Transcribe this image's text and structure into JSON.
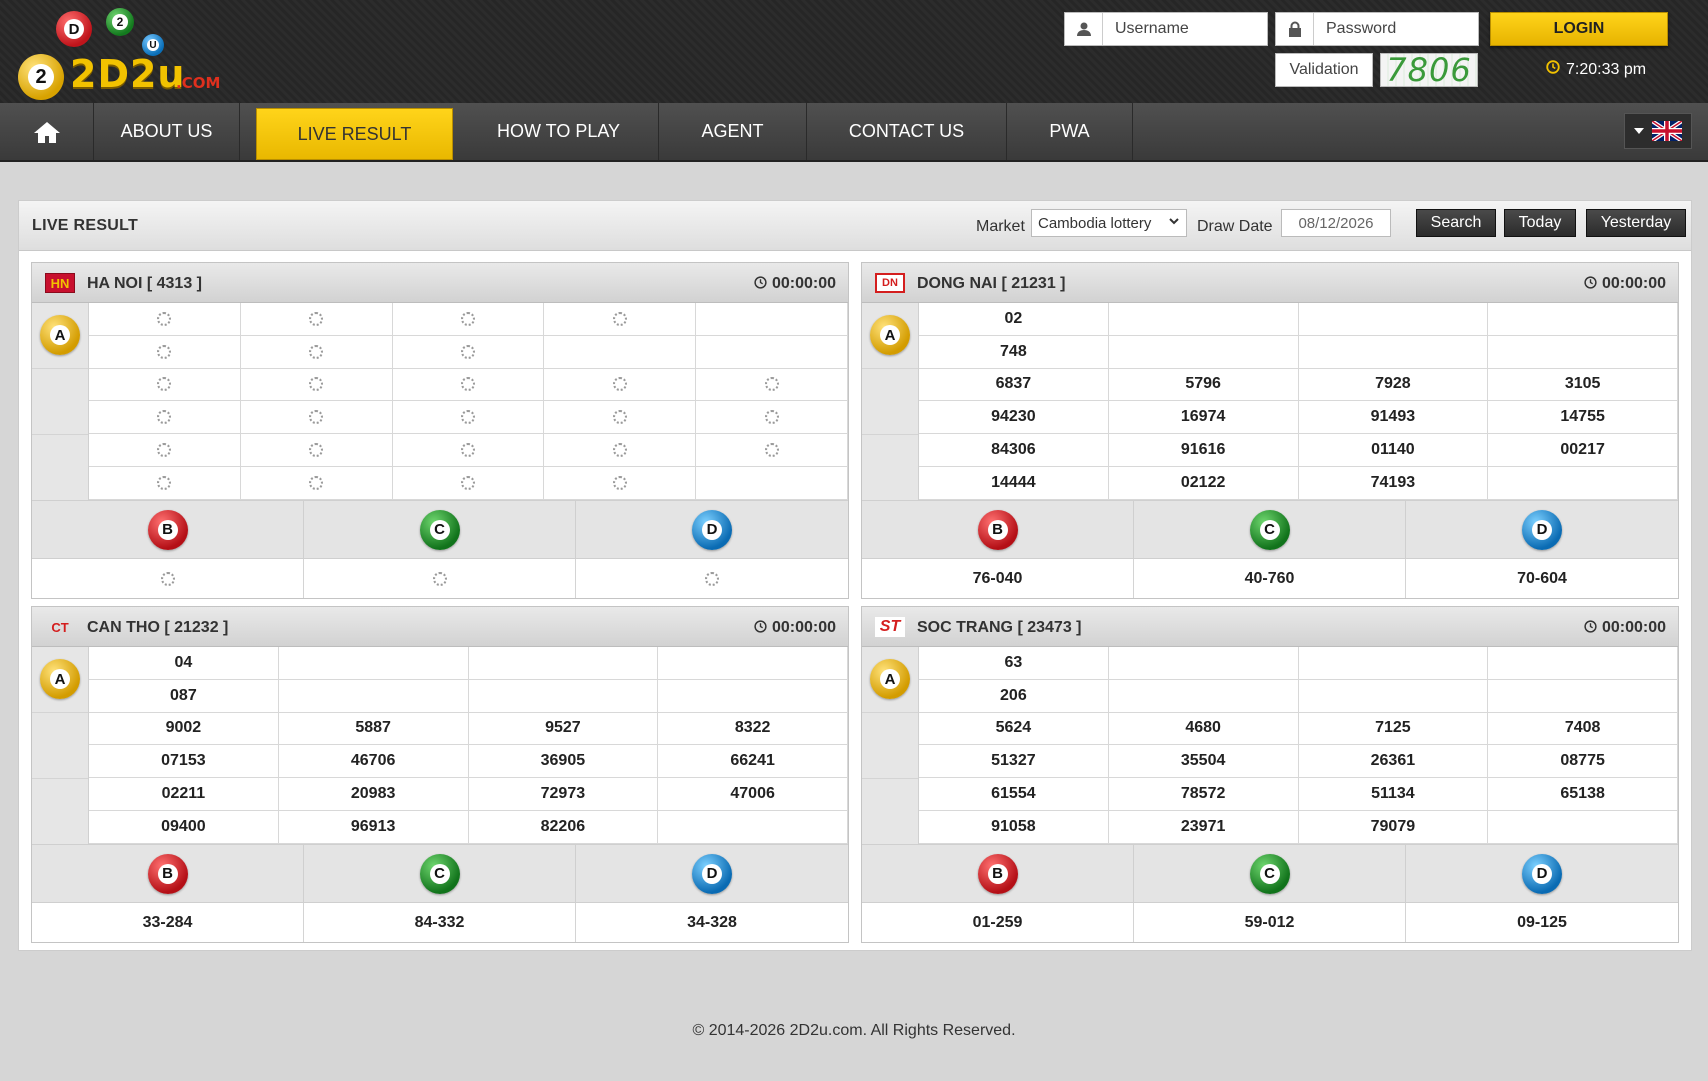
{
  "brand": {
    "logo_text": "2D2u",
    "logo_suffix": ".COM",
    "ball_letters": [
      "D",
      "2",
      "U",
      "2"
    ]
  },
  "login": {
    "username_placeholder": "Username",
    "password_placeholder": "Password",
    "validation_label": "Validation",
    "captcha": "7806",
    "login_label": "LOGIN",
    "time": "7:20:33 pm"
  },
  "nav": {
    "about": "ABOUT US",
    "live": "LIVE RESULT",
    "how": "HOW TO PLAY",
    "agent": "AGENT",
    "contact": "CONTACT US",
    "pwa": "PWA"
  },
  "toolbar": {
    "title": "LIVE RESULT",
    "market_label": "Market",
    "market_value": "Cambodia lottery",
    "date_label": "Draw Date",
    "date_value": "08/12/2026",
    "search": "Search",
    "today": "Today",
    "yesterday": "Yesterday"
  },
  "colors": {
    "accent": "#f2c200",
    "dark": "#2b2b2b"
  },
  "panels": [
    {
      "id": "hanoi",
      "flag": "HN",
      "name": "HA NOI [ 4313 ]",
      "time": "00:00:00",
      "cols": 5,
      "pending": true,
      "rows": [
        [
          1,
          1,
          1,
          1,
          0
        ],
        [
          1,
          1,
          1,
          0,
          0
        ],
        [
          1,
          1,
          1,
          1,
          1
        ],
        [
          1,
          1,
          1,
          1,
          1
        ],
        [
          1,
          1,
          1,
          1,
          1
        ],
        [
          1,
          1,
          1,
          1,
          0
        ]
      ],
      "bcd": [
        "",
        "",
        ""
      ]
    },
    {
      "id": "dongnai",
      "flag": "DN",
      "name": "DONG NAI [ 21231 ]",
      "time": "00:00:00",
      "cols": 4,
      "pending": false,
      "rows": [
        [
          "02",
          "",
          "",
          ""
        ],
        [
          "748",
          "",
          "",
          ""
        ],
        [
          "6837",
          "5796",
          "7928",
          "3105"
        ],
        [
          "94230",
          "16974",
          "91493",
          "14755"
        ],
        [
          "84306",
          "91616",
          "01140",
          "00217"
        ],
        [
          "14444",
          "02122",
          "74193",
          ""
        ]
      ],
      "bcd": [
        "76-040",
        "40-760",
        "70-604"
      ]
    },
    {
      "id": "cantho",
      "flag": "CT",
      "name": "CAN THO [ 21232 ]",
      "time": "00:00:00",
      "cols": 4,
      "pending": false,
      "rows": [
        [
          "04",
          "",
          "",
          ""
        ],
        [
          "087",
          "",
          "",
          ""
        ],
        [
          "9002",
          "5887",
          "9527",
          "8322"
        ],
        [
          "07153",
          "46706",
          "36905",
          "66241"
        ],
        [
          "02211",
          "20983",
          "72973",
          "47006"
        ],
        [
          "09400",
          "96913",
          "82206",
          ""
        ]
      ],
      "bcd": [
        "33-284",
        "84-332",
        "34-328"
      ]
    },
    {
      "id": "soctrang",
      "flag": "ST",
      "name": "SOC TRANG [ 23473 ]",
      "time": "00:00:00",
      "cols": 4,
      "pending": false,
      "rows": [
        [
          "63",
          "",
          "",
          ""
        ],
        [
          "206",
          "",
          "",
          ""
        ],
        [
          "5624",
          "4680",
          "7125",
          "7408"
        ],
        [
          "51327",
          "35504",
          "26361",
          "08775"
        ],
        [
          "61554",
          "78572",
          "51134",
          "65138"
        ],
        [
          "91058",
          "23971",
          "79079",
          ""
        ]
      ],
      "bcd": [
        "01-259",
        "59-012",
        "09-125"
      ]
    }
  ],
  "ball_labels": {
    "a": "A",
    "b": "B",
    "c": "C",
    "d": "D"
  },
  "footer": "© 2014-2026 2D2u.com. All Rights Reserved."
}
